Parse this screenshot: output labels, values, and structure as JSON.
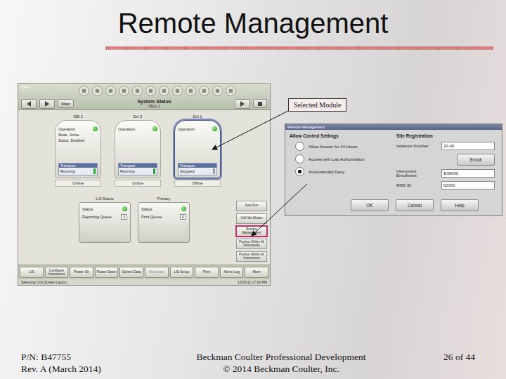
{
  "slide": {
    "title": "Remote Management",
    "callout": "Selected Module",
    "footer": {
      "left": [
        "P/N: B47755",
        "Rev. A (March 2014)"
      ],
      "center": [
        "Beckman Coulter Professional Development",
        "© 2014 Beckman Coulter, Inc."
      ],
      "page": "26 of 44"
    }
  },
  "screen": {
    "window_title": "Cell 1",
    "nav_label": "Main",
    "title": "System Status",
    "cell": "CELL 1",
    "modules": [
      {
        "name": "ISE 2",
        "operation": "Operation",
        "details": [
          {
            "label": "Mode:",
            "value": "Active"
          },
          {
            "label": "Status:",
            "value": "Disabled"
          }
        ],
        "transport": "Transport",
        "transport_state": "Running",
        "transport_running": true,
        "status": "Online",
        "selected": false
      },
      {
        "name": "DxI 2",
        "operation": "Operation",
        "details": [],
        "transport": "Transport",
        "transport_state": "Running",
        "transport_running": true,
        "status": "Online",
        "selected": false
      },
      {
        "name": "DxI 1",
        "operation": "Operation",
        "details": [],
        "transport": "Transport",
        "transport_state": "Stopped",
        "transport_running": false,
        "status": "Offline",
        "selected": true
      }
    ],
    "lis": {
      "title": "LIS Status",
      "status": "Status",
      "queue_label": "Reporting Queue",
      "queue": "3"
    },
    "printer": {
      "title": "Primary",
      "status": "Status",
      "queue_label": "Print Queue",
      "queue": "0"
    },
    "side_buttons": [
      {
        "label": "Auto Run",
        "selected": false
      },
      {
        "label": "Cell Idle Modes",
        "selected": false
      },
      {
        "label": "Remote Management",
        "selected": true
      },
      {
        "label": "Position Within All Instruments",
        "selected": false
      },
      {
        "label": "Position Within All Instruments",
        "selected": false
      }
    ],
    "toolbar": [
      {
        "label": "LIS",
        "disabled": false
      },
      {
        "label": "Configure Instrument",
        "disabled": false
      },
      {
        "label": "Power On",
        "disabled": false
      },
      {
        "label": "Power Down",
        "disabled": false
      },
      {
        "label": "Delete Data",
        "disabled": false
      },
      {
        "label": "Shutdown",
        "disabled": true
      },
      {
        "label": "LIS Setup",
        "disabled": false
      },
      {
        "label": "Print",
        "disabled": false
      },
      {
        "label": "Alerts Log",
        "disabled": false
      },
      {
        "label": "More",
        "disabled": false
      }
    ],
    "status_line": {
      "message": "Selecting Unit Screen Layout...",
      "time": "12/05/11 17:00 PM"
    }
  },
  "dialog": {
    "title": "Remote Management",
    "control": {
      "title": "Allow Control Settings",
      "options": [
        {
          "label": "Allow Access for 24 Hours",
          "selected": false
        },
        {
          "label": "Access with Lab Authorization",
          "selected": false
        },
        {
          "label": "Automatically Deny",
          "selected": true
        }
      ]
    },
    "site": {
      "title": "Site Registration",
      "instance_label": "Instance Number",
      "instance_value": "20-00",
      "enroll": "Enroll",
      "enrollment_label": "Instrument Enrollment",
      "enrollment_value": "E30030",
      "rms_label": "RMS ID",
      "rms_value": "02000"
    },
    "buttons": [
      "OK",
      "Cancel",
      "Help"
    ]
  }
}
